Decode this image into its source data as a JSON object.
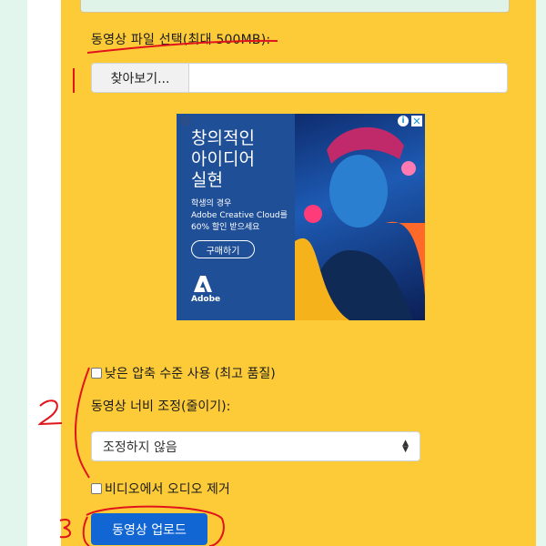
{
  "form": {
    "file_label": "동영상 파일 선택(최대 500MB):",
    "browse_button": "찾아보기...",
    "low_compression_label": "낮은 압축 수준 사용 (최고 품질)",
    "width_label": "동영상 너비 조정(줄이기):",
    "width_select_value": "조정하지 않음",
    "remove_audio_label": "비디오에서 오디오 제거",
    "upload_button": "동영상 업로드"
  },
  "ad": {
    "headline_lines": [
      "창의적인",
      "아이디어",
      "실현"
    ],
    "sub_lines": [
      "학생의 경우",
      "Adobe Creative Cloud를",
      "60% 할인 받으세요"
    ],
    "cta": "구매하기",
    "brand": "Adobe"
  },
  "annotations": {
    "mark_2": "2",
    "mark_3": "3"
  },
  "colors": {
    "panel": "#fdcb38",
    "upload_button": "#1266d4",
    "annotation": "#e0141a"
  }
}
